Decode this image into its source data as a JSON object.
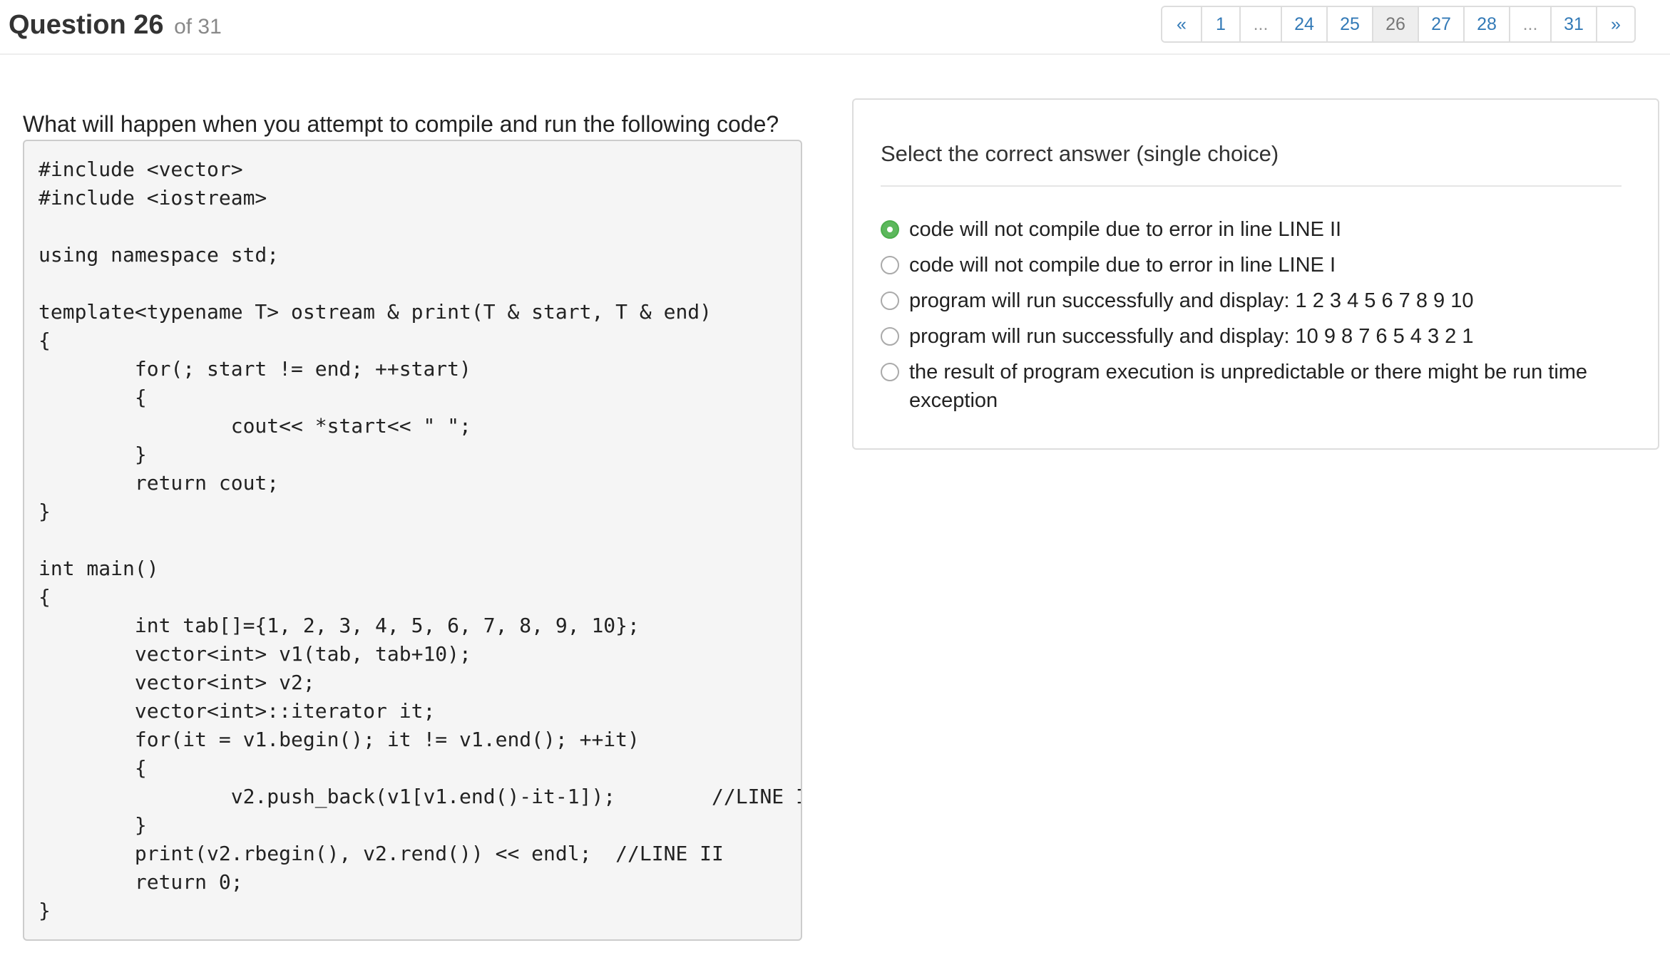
{
  "header": {
    "question_label": "Question 26",
    "of_label": "of 31"
  },
  "pagination": [
    {
      "label": "«",
      "name": "page-prev-link"
    },
    {
      "label": "1",
      "name": "page-link-1"
    },
    {
      "label": "...",
      "name": "page-ellipsis-1"
    },
    {
      "label": "24",
      "name": "page-link-24"
    },
    {
      "label": "25",
      "name": "page-link-25"
    },
    {
      "label": "26",
      "name": "page-link-26-current"
    },
    {
      "label": "27",
      "name": "page-link-27"
    },
    {
      "label": "28",
      "name": "page-link-28"
    },
    {
      "label": "...",
      "name": "page-ellipsis-2"
    },
    {
      "label": "31",
      "name": "page-link-31"
    },
    {
      "label": "»",
      "name": "page-next-link"
    }
  ],
  "pagination_current": "26",
  "question": {
    "text": "What will happen when you attempt to compile and run the following code?",
    "code_lines": [
      "#include <vector>",
      "#include <iostream>",
      "",
      "using namespace std;",
      "",
      "template<typename T> ostream & print(T & start, T & end)",
      "{",
      "        for(; start != end; ++start)",
      "        {",
      "                cout<< *start<< \" \";",
      "        }",
      "        return cout;",
      "}",
      "",
      "int main()",
      "{",
      "        int tab[]={1, 2, 3, 4, 5, 6, 7, 8, 9, 10};",
      "        vector<int> v1(tab, tab+10);",
      "        vector<int> v2;",
      "        vector<int>::iterator it;",
      "        for(it = v1.begin(); it != v1.end(); ++it)",
      "        {",
      "                v2.push_back(v1[v1.end()-it-1]);        //LINE I",
      "        }",
      "        print(v2.rbegin(), v2.rend()) << endl;  //LINE II",
      "        return 0;",
      "}"
    ]
  },
  "answers": {
    "title": "Select the correct answer (single choice)",
    "selected_index": 0,
    "options": [
      "code will not compile due to error in line LINE II",
      "code will not compile due to error in line LINE I",
      "program will run successfully and display: 1 2 3 4 5 6 7 8 9 10",
      "program will run successfully and display: 10 9 8 7 6 5 4 3 2 1",
      "the result of program execution is unpredictable or there might be run time exception"
    ]
  },
  "colors": {
    "link": "#337ab7",
    "selected_radio": "#5cb85c"
  }
}
